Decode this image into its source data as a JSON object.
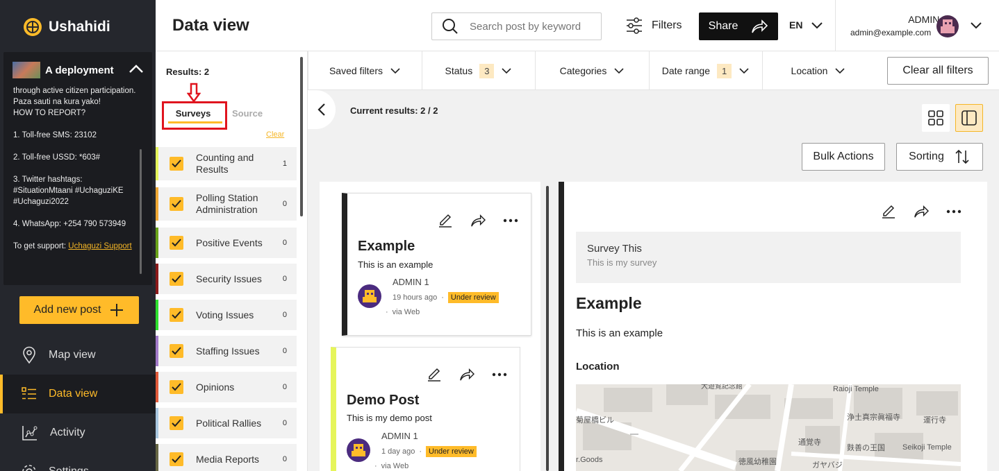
{
  "app": {
    "brand": "Ushahidi"
  },
  "deployment": {
    "name": "A deployment",
    "description": "through active citizen participation. Paza sauti na kura yako!\nHOW TO REPORT?\n\n1. Toll-free SMS: 23102\n\n2. Toll-free USSD: *603#\n\n3. Twitter hashtags: #SituationMtaani #UchaguziKE #Uchaguzi2022\n\n4. WhatsApp: +254 790 573949\n\nTo get support: ",
    "support_link": "Uchaguzi Support"
  },
  "sidebar": {
    "add_post": "Add new post",
    "nav": [
      {
        "label": "Map view",
        "icon": "map-pin-icon"
      },
      {
        "label": "Data view",
        "icon": "list-icon"
      },
      {
        "label": "Activity",
        "icon": "activity-icon"
      },
      {
        "label": "Settings",
        "icon": "gear-icon"
      }
    ]
  },
  "header": {
    "title": "Data view",
    "search_placeholder": "Search post by keyword",
    "filters_label": "Filters",
    "share_label": "Share",
    "language": "EN",
    "user_name": "ADMIN 1",
    "user_email": "admin@example.com"
  },
  "filterbar": {
    "saved_filters": "Saved filters",
    "status": "Status",
    "status_count": "3",
    "categories": "Categories",
    "date_range": "Date range",
    "date_range_count": "1",
    "location": "Location",
    "clear_all": "Clear all filters"
  },
  "surveys_panel": {
    "results": "Results: 2",
    "tab_surveys": "Surveys",
    "tab_source": "Source",
    "clear": "Clear",
    "items": [
      {
        "label": "Counting and Results",
        "count": "1",
        "color": "#e6f55b"
      },
      {
        "label": "Polling Station Administration",
        "count": "0",
        "color": "#f0a935"
      },
      {
        "label": "Positive Events",
        "count": "0",
        "color": "#6aa31a"
      },
      {
        "label": "Security Issues",
        "count": "0",
        "color": "#8b1a1a"
      },
      {
        "label": "Voting Issues",
        "count": "0",
        "color": "#2ee02e"
      },
      {
        "label": "Staffing Issues",
        "count": "0",
        "color": "#a27ac9"
      },
      {
        "label": "Opinions",
        "count": "0",
        "color": "#e05a3a"
      },
      {
        "label": "Political Rallies",
        "count": "0",
        "color": "#a9c7e0"
      },
      {
        "label": "Media Reports",
        "count": "0",
        "color": "#666644"
      }
    ]
  },
  "main": {
    "current_results": "Current results: 2 / 2",
    "bulk_actions": "Bulk Actions",
    "sorting": "Sorting"
  },
  "posts": [
    {
      "title": "Example",
      "desc": "This is an example",
      "author": "ADMIN 1",
      "time": "19 hours ago",
      "status": "Under review",
      "via": "via Web"
    },
    {
      "title": "Demo Post",
      "desc": "This is my demo post",
      "author": "ADMIN 1",
      "time": "1 day ago",
      "status": "Under review",
      "via": "via Web"
    }
  ],
  "detail": {
    "survey_title": "Survey This",
    "survey_desc": "This is my survey",
    "title": "Example",
    "desc": "This is an example",
    "location_label": "Location",
    "map_labels": [
      "Raioji Temple",
      "菊屋橋ビル",
      "浄土真宗眞福寺",
      "運行寺",
      "通覚寺",
      "麩善の王国",
      "Seikoji Temple",
      "徳風幼稚園",
      "ガヤバジ",
      "r.Goods",
      "大遊覧記念館"
    ]
  },
  "colors": {
    "accent": "#ffbb29",
    "sidebar_bg": "#25272d",
    "highlight": "#e0141e"
  }
}
